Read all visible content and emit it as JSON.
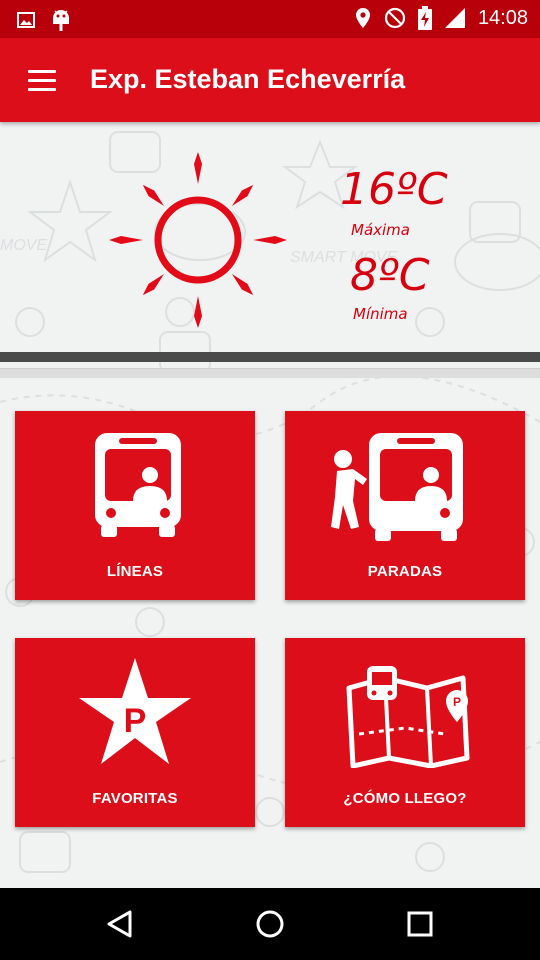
{
  "status_bar": {
    "time": "14:08",
    "icons": [
      "image-icon",
      "android-icon",
      "location-icon",
      "do-not-disturb-icon",
      "battery-charging-icon",
      "signal-icon"
    ]
  },
  "app_bar": {
    "title": "Exp. Esteban Echeverría",
    "menu_icon": "menu-icon"
  },
  "weather": {
    "max_temp": "16ºC",
    "max_label": "Máxima",
    "min_temp": "8ºC",
    "min_label": "Mínima",
    "icon": "sun-icon"
  },
  "tiles": [
    {
      "label": "LÍNEAS",
      "icon": "bus-icon"
    },
    {
      "label": "PARADAS",
      "icon": "bus-stop-icon"
    },
    {
      "label": "FAVORITAS",
      "icon": "star-parking-icon"
    },
    {
      "label": "¿CÓMO LLEGO?",
      "icon": "map-icon"
    }
  ],
  "colors": {
    "status_bar": "#b8000a",
    "primary": "#dc0e1a",
    "temperature_text": "#d7000f",
    "background": "#f1f2f2"
  },
  "nav_bar": {
    "icons": [
      "back-icon",
      "home-icon",
      "recents-icon"
    ]
  }
}
